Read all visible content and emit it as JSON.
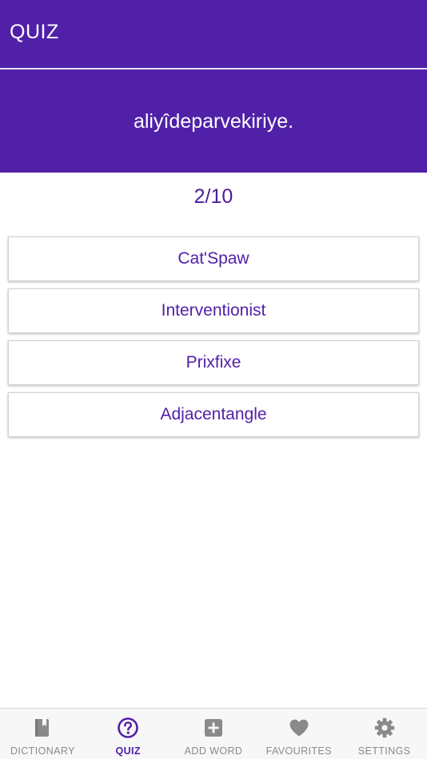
{
  "header": {
    "title": "QUIZ"
  },
  "question": {
    "text": "aliyîdeparvekiriye."
  },
  "progress": {
    "text": "2/10"
  },
  "options": [
    {
      "label": "Cat'Spaw"
    },
    {
      "label": "Interventionist"
    },
    {
      "label": "Prixfixe"
    },
    {
      "label": "Adjacentangle"
    }
  ],
  "tabbar": {
    "active": "quiz",
    "items": [
      {
        "label": "DICTIONARY",
        "icon": "book-icon"
      },
      {
        "label": "QUIZ",
        "icon": "question-circle-icon"
      },
      {
        "label": "ADD WORD",
        "icon": "plus-square-icon"
      },
      {
        "label": "FAVOURITES",
        "icon": "heart-icon"
      },
      {
        "label": "SETTINGS",
        "icon": "gear-icon"
      }
    ]
  },
  "colors": {
    "primary": "#5120a8",
    "inactive_icon": "#8a8a8a",
    "background": "#ffffff"
  }
}
